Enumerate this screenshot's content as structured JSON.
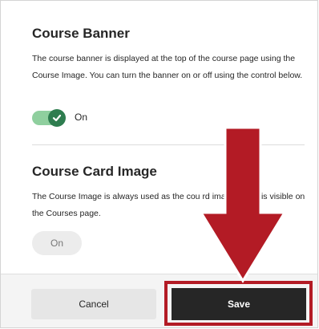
{
  "course_banner": {
    "title": "Course Banner",
    "description": "The course banner is displayed at the top of the course page using the Course Image. You can turn the banner on or off using the control below.",
    "toggle_label": "On",
    "toggle_state": "on"
  },
  "course_card_image": {
    "title": "Course Card Image",
    "description": "The Course Image is always used as the cou          rd image which is visible on the Courses page.",
    "toggle_label": "On",
    "toggle_state": "disabled"
  },
  "footer": {
    "cancel_label": "Cancel",
    "save_label": "Save"
  },
  "colors": {
    "toggle_on": "#2e7d4f",
    "highlight": "#b31b25",
    "save_bg": "#262626"
  },
  "icons": {
    "toggle_check": "check-icon",
    "callout": "down-arrow-icon"
  }
}
